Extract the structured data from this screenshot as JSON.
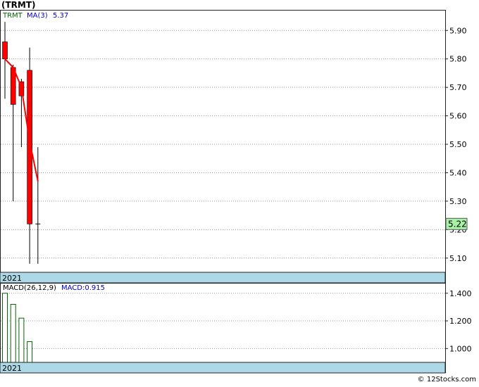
{
  "title": "(TRMT)",
  "legend": {
    "symbol": "TRMT",
    "ma_label": "MA(3)",
    "ma_value": "5.37"
  },
  "last_price": "5.22",
  "year_label": "2021",
  "macd_legend": {
    "label": "MACD(26,12,9)",
    "value_label": "MACD:0.915"
  },
  "footer": "© 12Stocks.com",
  "colors": {
    "down": "#ff0000",
    "ma": "#ff0000",
    "macd_bar": "#006400",
    "symbol_text": "#006400",
    "ma_text": "#0000cc",
    "year_band": "#add8e6",
    "last_price_badge": "#a7f2a7"
  },
  "chart_data": [
    {
      "type": "candlestick",
      "title": "(TRMT)",
      "ylim": [
        5.05,
        5.97
      ],
      "yticks": [
        "5.10",
        "5.20",
        "5.30",
        "5.40",
        "5.50",
        "5.60",
        "5.70",
        "5.80",
        "5.90"
      ],
      "grid": true,
      "candles": [
        {
          "open": 5.86,
          "high": 5.93,
          "low": 5.66,
          "close": 5.8
        },
        {
          "open": 5.77,
          "high": 5.78,
          "low": 5.3,
          "close": 5.64
        },
        {
          "open": 5.72,
          "high": 5.73,
          "low": 5.49,
          "close": 5.67
        },
        {
          "open": 5.76,
          "high": 5.84,
          "low": 5.08,
          "close": 5.22
        },
        {
          "open": 5.22,
          "high": 5.49,
          "low": 5.08,
          "close": 5.22
        }
      ],
      "ma": {
        "name": "MA(3)",
        "values": [
          5.8,
          5.77,
          5.7,
          5.51,
          5.37
        ]
      },
      "last_value": 5.22
    },
    {
      "type": "bar",
      "title": "MACD(26,12,9)",
      "ylim": [
        0.9,
        1.47
      ],
      "yticks": [
        "1.000",
        "1.200",
        "1.400"
      ],
      "grid": true,
      "values": [
        1.4,
        1.32,
        1.22,
        1.05
      ],
      "last_value": 0.915
    }
  ]
}
